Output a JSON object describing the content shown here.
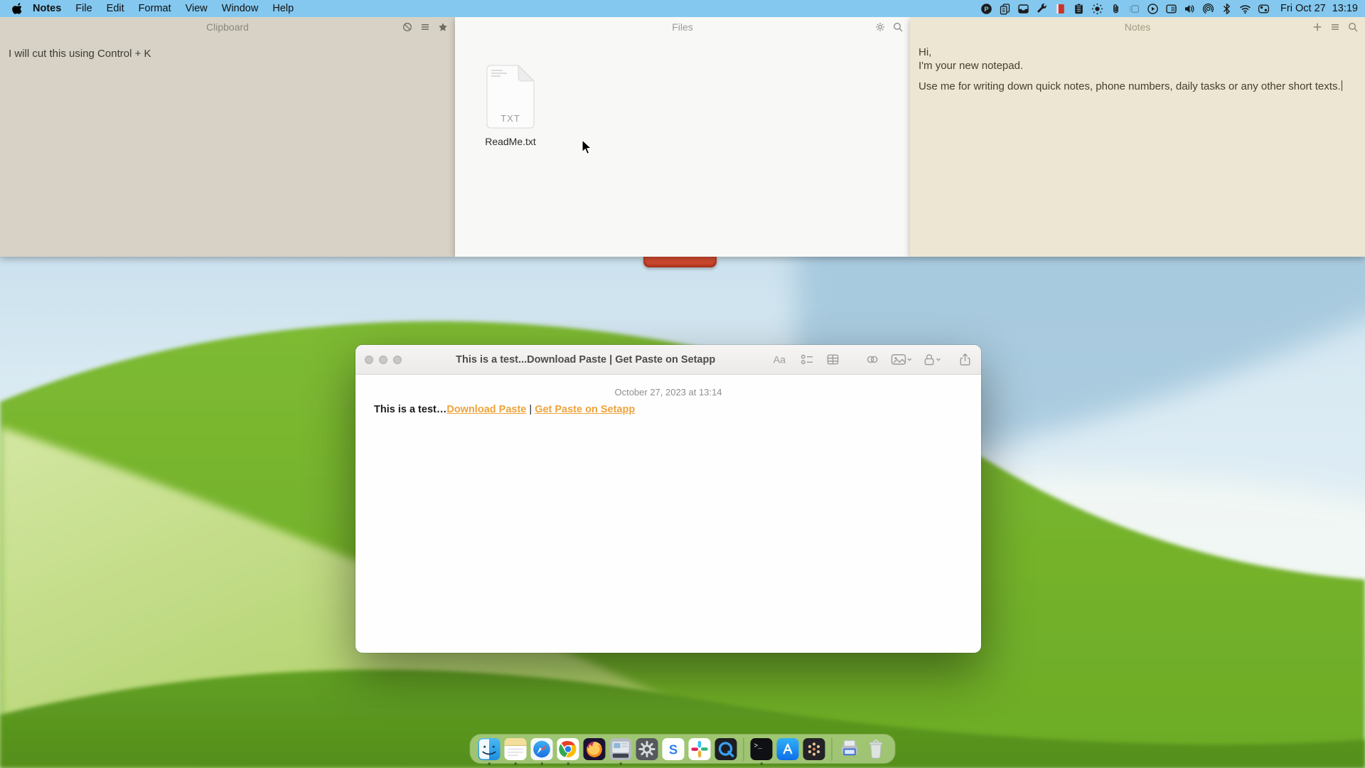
{
  "menubar": {
    "app_name": "Notes",
    "menus": [
      "File",
      "Edit",
      "Format",
      "View",
      "Window",
      "Help"
    ],
    "status_icons": [
      "paste-app",
      "copy-documents",
      "drawer",
      "wrench",
      "red-notebook",
      "clipboard",
      "brightness",
      "paperclip",
      "keyboard-brightness",
      "play-circle",
      "window-tiles",
      "volume",
      "screen-mirroring",
      "bluetooth",
      "wifi",
      "control-center"
    ],
    "clock": {
      "date": "Fri Oct 27",
      "time": "13:19"
    }
  },
  "panels": {
    "clipboard": {
      "title": "Clipboard",
      "actions": [
        "block",
        "menu",
        "star"
      ],
      "content": "I will cut this using Control + K"
    },
    "files": {
      "title": "Files",
      "actions": [
        "settings",
        "search"
      ],
      "file": {
        "type_label": "TXT",
        "name": "ReadMe.txt"
      }
    },
    "notes": {
      "title": "Notes",
      "actions": [
        "add",
        "menu",
        "search"
      ],
      "line1": "Hi,",
      "line2": "I'm your new notepad.",
      "line3": "Use me for writing down quick notes, phone numbers, daily tasks or any other short texts."
    }
  },
  "notes_window": {
    "title": "This is a test...Download Paste | Get Paste on Setapp",
    "toolbar": [
      "format",
      "checklist",
      "table",
      "link",
      "media",
      "lock",
      "share"
    ],
    "date_line": "October 27, 2023 at 13:14",
    "body_prefix": "This is a test…",
    "link1": "Download Paste",
    "separator": "|",
    "link2": "Get Paste on Setapp"
  },
  "dock": {
    "sections": [
      [
        {
          "name": "finder",
          "running": true
        },
        {
          "name": "notes",
          "running": true
        },
        {
          "name": "safari",
          "running": true
        },
        {
          "name": "chrome",
          "running": true
        },
        {
          "name": "firefox",
          "running": false
        },
        {
          "name": "unclutter",
          "running": true
        },
        {
          "name": "system-settings",
          "running": false
        },
        {
          "name": "s-app",
          "running": false
        },
        {
          "name": "slack",
          "running": false
        },
        {
          "name": "quicktime",
          "running": false
        }
      ],
      [
        {
          "name": "terminal",
          "running": true
        },
        {
          "name": "app-store",
          "running": false
        },
        {
          "name": "setapp",
          "running": false
        }
      ],
      [
        {
          "name": "printer",
          "running": false
        },
        {
          "name": "trash",
          "running": false
        }
      ]
    ]
  },
  "colors": {
    "menubar": "#84c8ef",
    "link": "#f0a33c",
    "red_window_peek": "#d24b30",
    "hill_green": "#7db832",
    "dark_green": "#5f9e20",
    "sky": "#cfe4f0",
    "clipboard_bg": "#d7d2c5",
    "files_bg": "#f8f8f6",
    "notes_bg": "#ece6d2"
  }
}
